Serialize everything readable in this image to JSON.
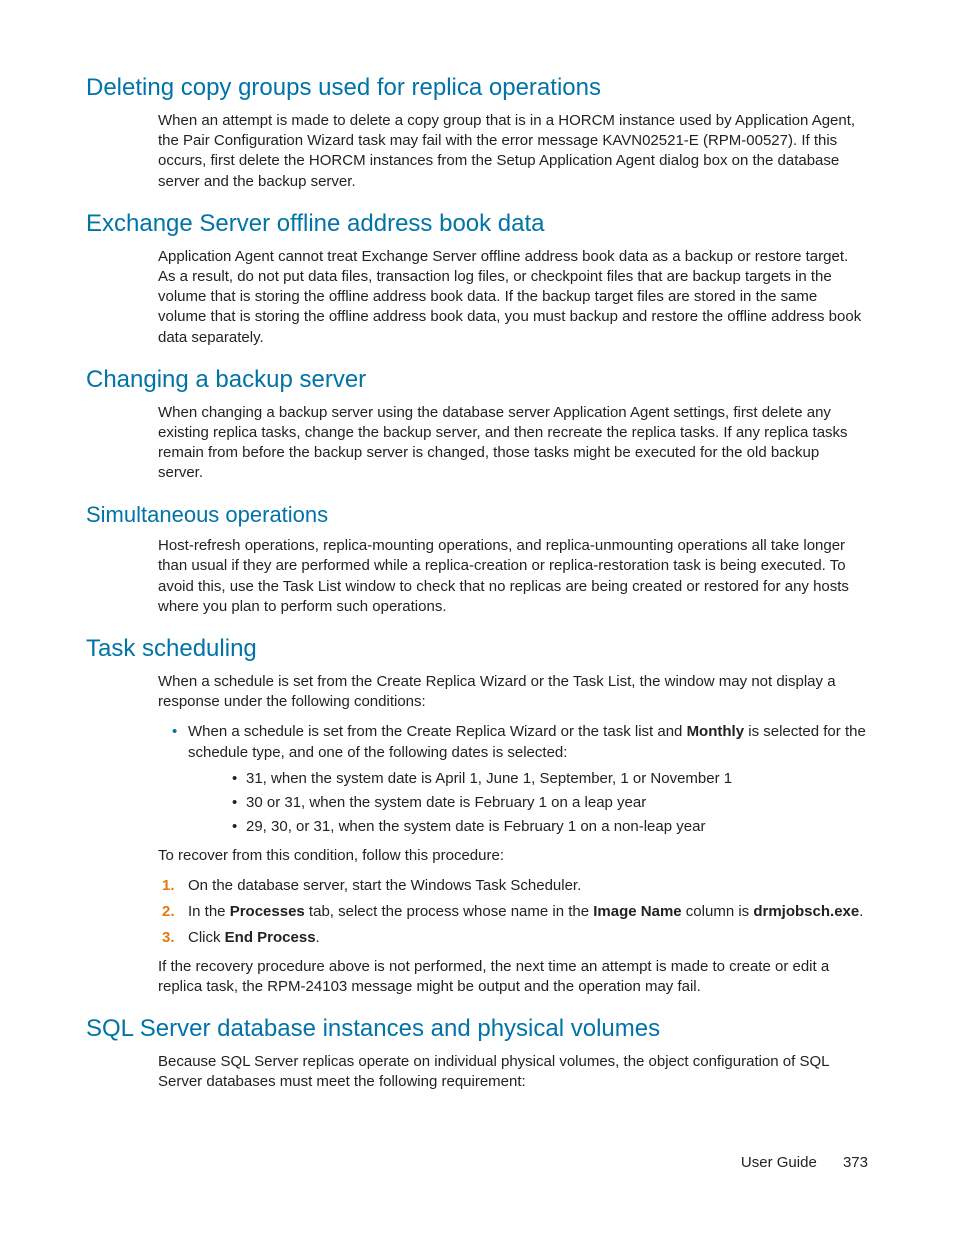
{
  "sections": {
    "s1": {
      "title": "Deleting copy groups used for replica operations",
      "p1": "When an attempt is made to delete a copy group that is in a HORCM instance used by Application Agent, the Pair Configuration Wizard task may fail with the error message KAVN02521-E (RPM-00527). If this occurs, first delete the HORCM instances from the Setup Application Agent dialog box on the database server and the backup server."
    },
    "s2": {
      "title": "Exchange Server offline address book data",
      "p1": "Application Agent cannot treat Exchange Server offline address book data as a backup or restore target. As a result, do not put data files, transaction log files, or checkpoint files that are backup targets in the volume that is storing the offline address book data. If the backup target files are stored in the same volume that is storing the offline address book data, you must backup and restore the offline address book data separately."
    },
    "s3": {
      "title": "Changing a backup server",
      "p1": "When changing a backup server using the database server Application Agent settings, first delete any existing replica tasks, change the backup server, and then recreate the replica tasks. If any replica tasks remain from before the backup server is changed, those tasks might be executed for the old backup server."
    },
    "s4": {
      "title": "Simultaneous operations",
      "p1": "Host-refresh operations, replica-mounting operations, and replica-unmounting operations all take longer than usual if they are performed while a replica-creation or replica-restoration task is being executed. To avoid this, use the Task List window to check that no replicas are being created or restored for any hosts where you plan to perform such operations."
    },
    "s5": {
      "title": "Task scheduling",
      "p1": "When a schedule is set from the Create Replica Wizard or the Task List, the window may not display a response under the following conditions:",
      "b1a": "When a schedule is set from the Create Replica Wizard or the task list and ",
      "b1b": "Monthly",
      "b1c": " is selected for the schedule type, and one of the following dates is selected:",
      "sb1": "31, when the system date is April 1, June 1, September, 1 or November 1",
      "sb2": "30 or 31, when the system date is February 1 on a leap year",
      "sb3": "29, 30, or 31, when the system date is February 1 on a non-leap year",
      "p2": "To recover from this condition, follow this procedure:",
      "step1": "On the database server, start the Windows Task Scheduler.",
      "step2a": "In the ",
      "step2b": "Processes",
      "step2c": " tab, select the process whose name in the ",
      "step2d": "Image Name",
      "step2e": " column is ",
      "step2f": "drmjobsch.exe",
      "step2g": ".",
      "step3a": "Click ",
      "step3b": "End Process",
      "step3c": ".",
      "p3": "If the recovery procedure above is not performed, the next time an attempt is made to create or edit a replica task, the RPM-24103 message might be output and the operation may fail."
    },
    "s6": {
      "title": "SQL Server database instances and physical volumes",
      "p1": "Because SQL Server replicas operate on individual physical volumes, the object configuration of SQL Server databases must meet the following requirement:"
    }
  },
  "footer": {
    "label": "User Guide",
    "page": "373"
  }
}
